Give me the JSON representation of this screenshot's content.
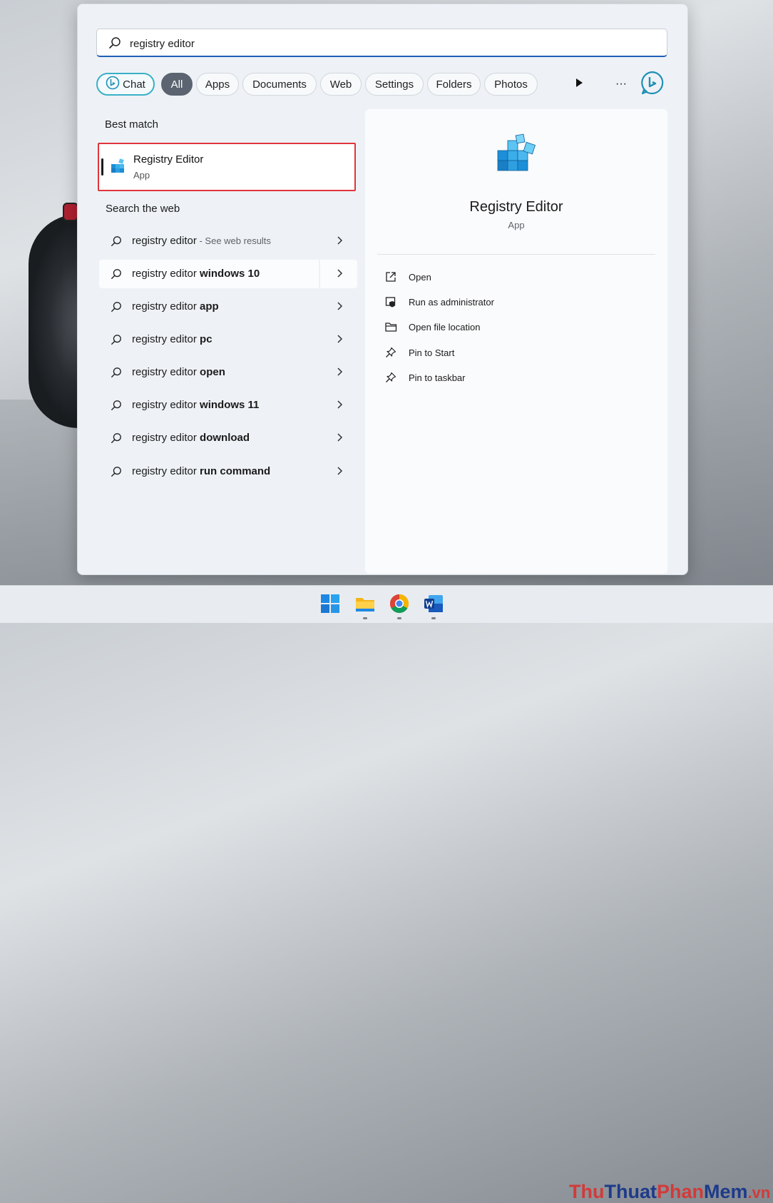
{
  "search": {
    "value": "registry editor"
  },
  "filters": {
    "chat": "Chat",
    "all": "All",
    "apps": "Apps",
    "documents": "Documents",
    "web": "Web",
    "settings": "Settings",
    "folders": "Folders",
    "photos": "Photos",
    "more": "···"
  },
  "best_match": {
    "heading": "Best match",
    "title": "Registry Editor",
    "subtitle": "App"
  },
  "web_results": {
    "heading": "Search the web",
    "items": [
      {
        "prefix": "registry editor",
        "bold": "",
        "hint": " - See web results"
      },
      {
        "prefix": "registry editor ",
        "bold": "windows 10",
        "hint": ""
      },
      {
        "prefix": "registry editor ",
        "bold": "app",
        "hint": ""
      },
      {
        "prefix": "registry editor ",
        "bold": "pc",
        "hint": ""
      },
      {
        "prefix": "registry editor ",
        "bold": "open",
        "hint": ""
      },
      {
        "prefix": "registry editor ",
        "bold": "windows 11",
        "hint": ""
      },
      {
        "prefix": "registry editor ",
        "bold": "download",
        "hint": ""
      },
      {
        "prefix": "registry editor ",
        "bold": "run command",
        "hint": ""
      }
    ]
  },
  "detail": {
    "name": "Registry Editor",
    "type": "App",
    "actions": [
      {
        "label": "Open",
        "icon": "open-external-icon"
      },
      {
        "label": "Run as administrator",
        "icon": "shield-admin-icon"
      },
      {
        "label": "Open file location",
        "icon": "folder-icon"
      },
      {
        "label": "Pin to Start",
        "icon": "pin-icon"
      },
      {
        "label": "Pin to taskbar",
        "icon": "pin-icon"
      }
    ]
  },
  "watermark": {
    "part1": "Thu",
    "part2": "Thuat",
    "part3": "Phan",
    "part4": "Mem",
    "part5": ".vn"
  },
  "colors": {
    "accent": "#1f5fb8",
    "highlight_border": "#e0343b",
    "chat_border": "#3ab0c8",
    "active_pill": "#5b6470"
  }
}
